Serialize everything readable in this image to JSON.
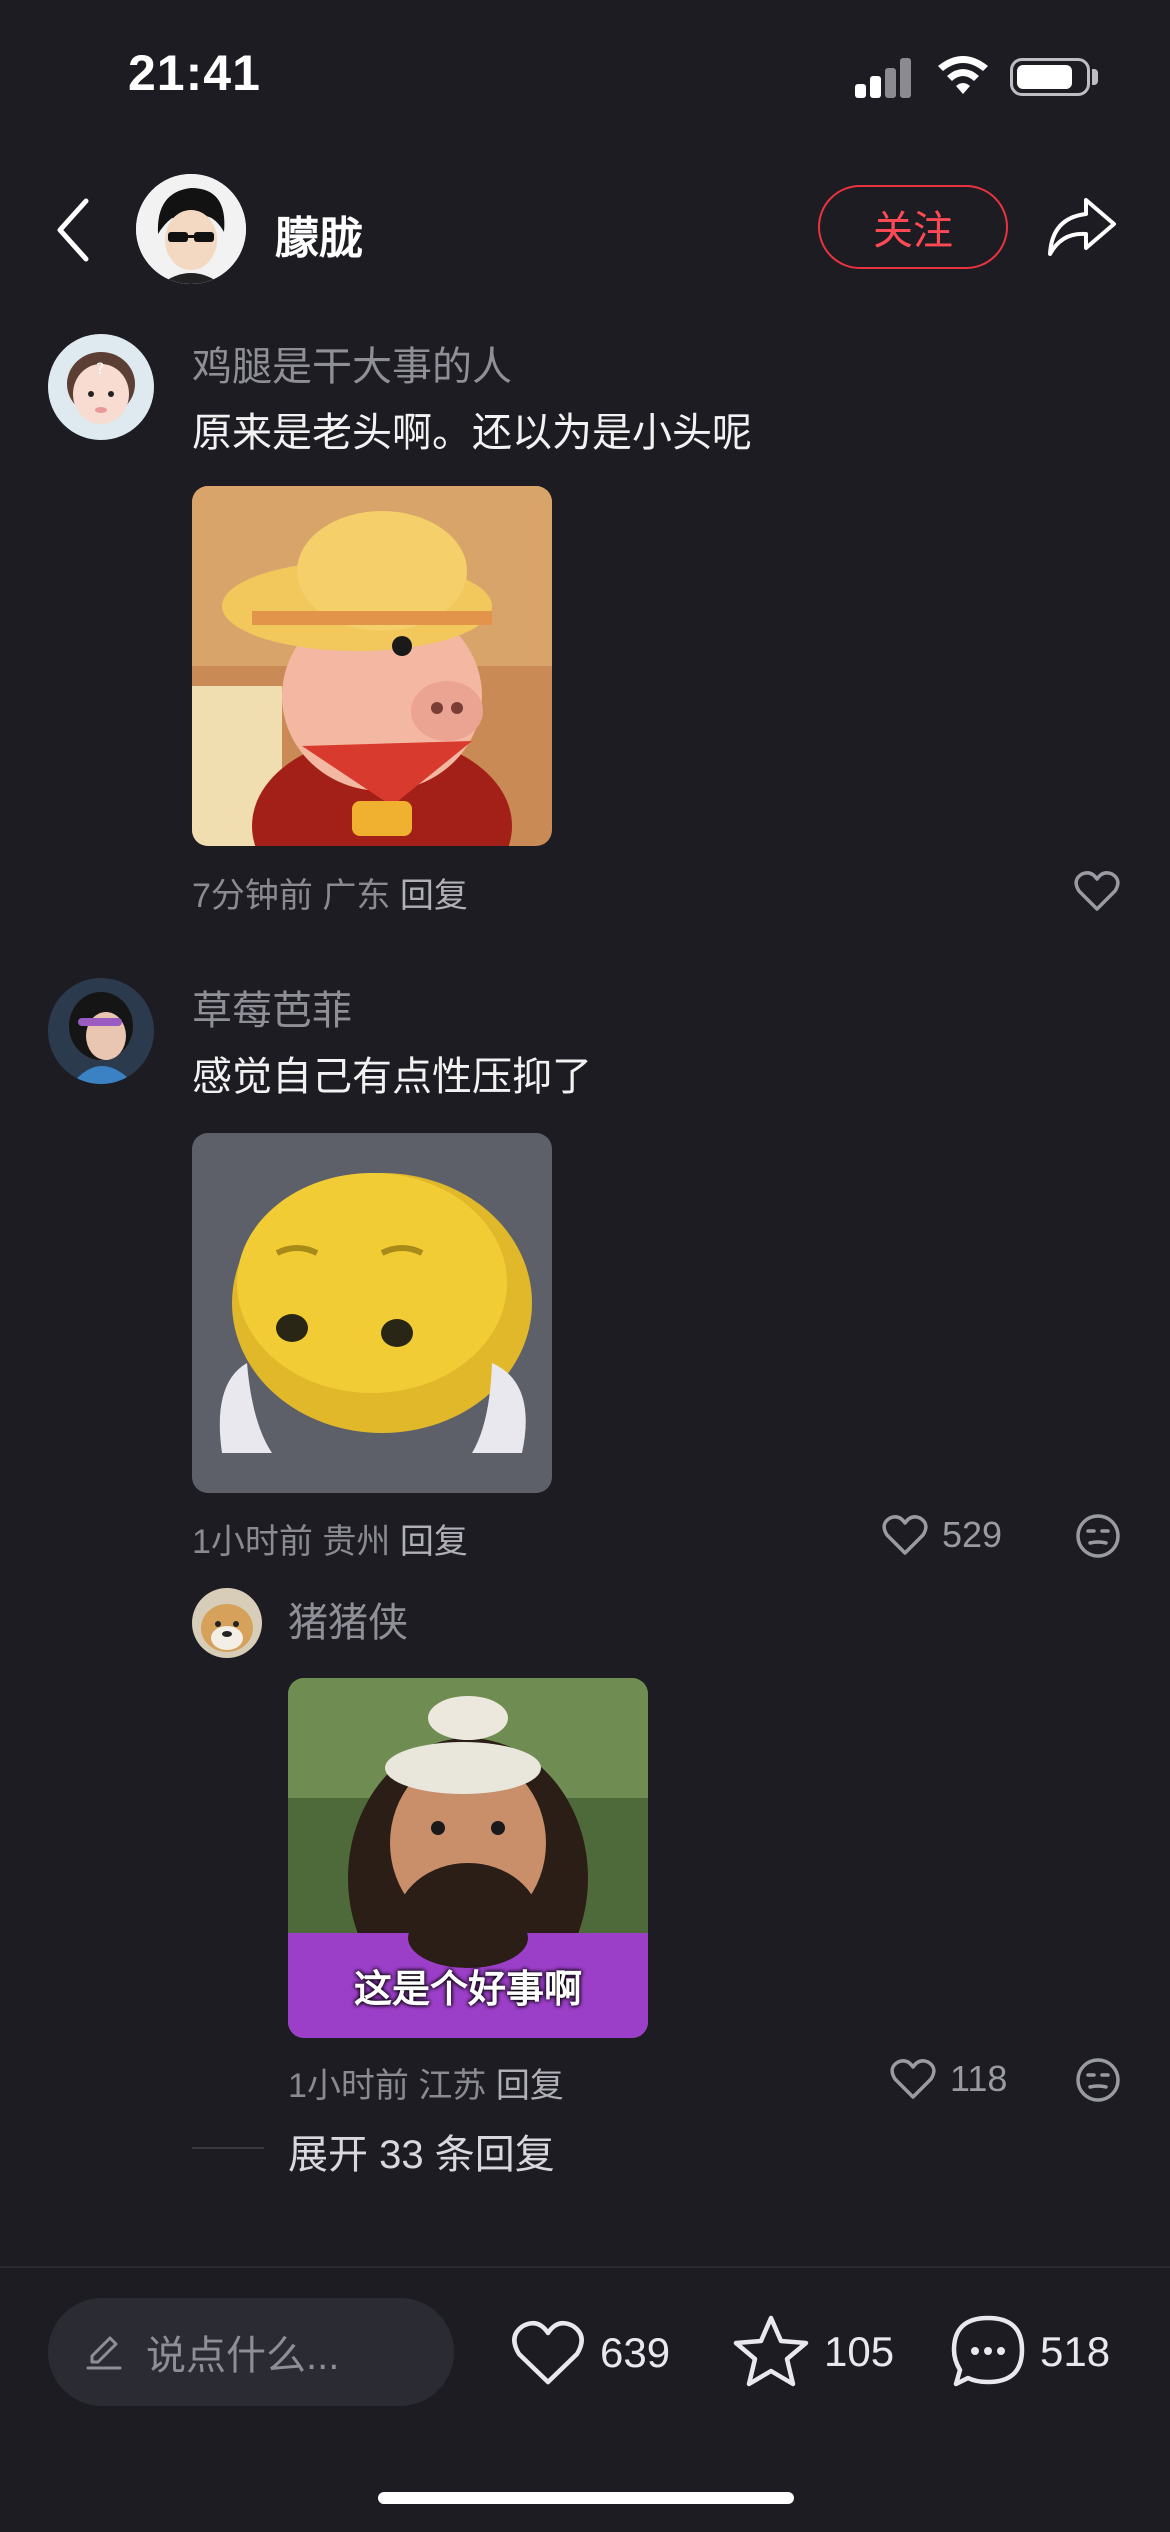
{
  "status_bar": {
    "time": "21:41"
  },
  "header": {
    "username": "朦胧",
    "follow_label": "关注"
  },
  "comments": [
    {
      "username": "鸡腿是干大事的人",
      "text": "原来是老头啊。还以为是小头呢",
      "meta_time": "7分钟前",
      "meta_location": "广东",
      "reply_label": "回复",
      "likes": ""
    },
    {
      "username": "草莓芭菲",
      "text": "感觉自己有点性压抑了",
      "meta_time": "1小时前",
      "meta_location": "贵州",
      "reply_label": "回复",
      "likes": "529"
    }
  ],
  "reply": {
    "username": "猪猪侠",
    "sticker_caption": "这是个好事啊",
    "meta_time": "1小时前",
    "meta_location": "江苏",
    "reply_label": "回复",
    "likes": "118"
  },
  "expand_label": "展开 33 条回复",
  "bottom_bar": {
    "input_placeholder": "说点什么...",
    "likes": "639",
    "favorites": "105",
    "comments": "518"
  },
  "colors": {
    "background": "#1c1c22",
    "accent": "#e8343f",
    "muted_text": "#8f8f97"
  },
  "icons": [
    "back-chevron-icon",
    "share-icon",
    "heart-icon",
    "emoji-icon",
    "pencil-icon",
    "star-icon",
    "comment-bubble-icon"
  ]
}
